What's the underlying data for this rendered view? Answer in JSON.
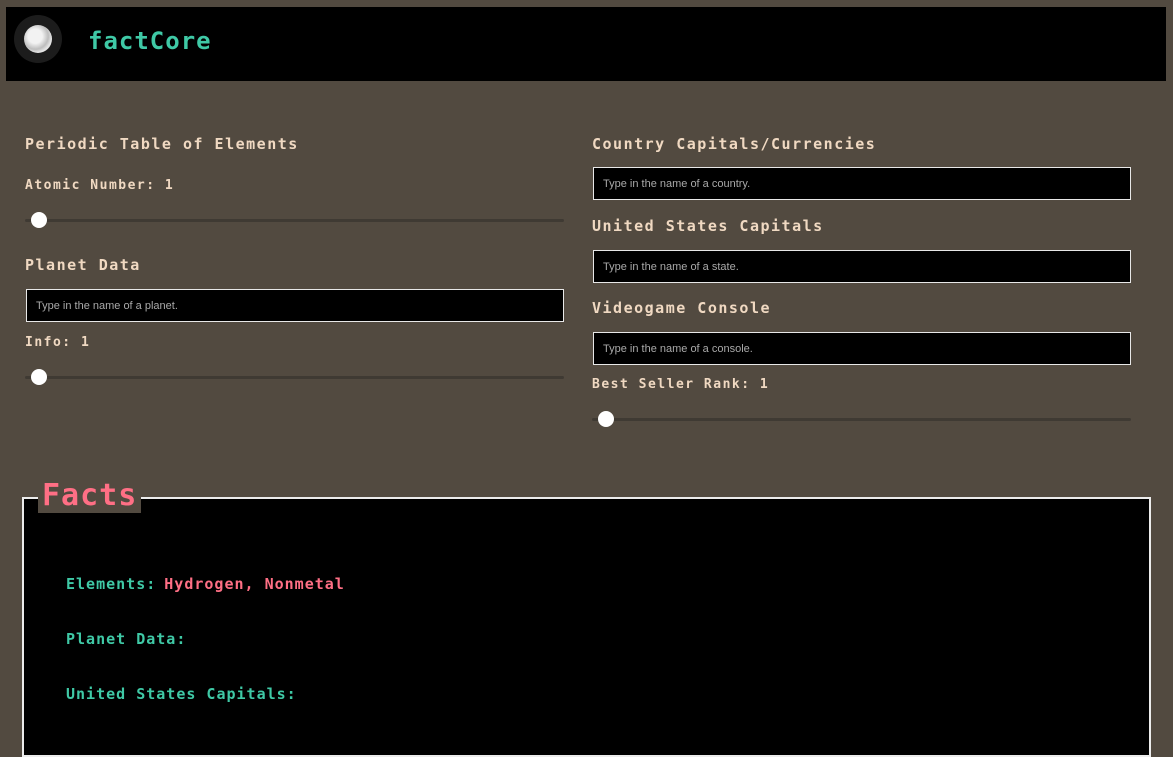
{
  "app": {
    "title": "factCore"
  },
  "left": {
    "periodic": {
      "heading": "Periodic Table of Elements",
      "atomic_label": "Atomic Number:",
      "atomic_value": "1",
      "atomic_level": 0
    },
    "planet": {
      "heading": "Planet Data",
      "placeholder": "Type in the name of a planet.",
      "info_label": "Info:",
      "info_value": "1",
      "info_level": 0
    }
  },
  "right": {
    "country": {
      "heading": "Country Capitals/Currencies",
      "placeholder": "Type in the name of a country."
    },
    "states": {
      "heading": "United States Capitals",
      "placeholder": "Type in the name of a state."
    },
    "console": {
      "heading": "Videogame Console",
      "placeholder": "Type in the name of a console.",
      "rank_label": "Best Seller Rank:",
      "rank_value": "1",
      "rank_level": 0
    }
  },
  "facts": {
    "title": "Facts",
    "rows": [
      {
        "key": "Elements:",
        "value": "Hydrogen, Nonmetal"
      },
      {
        "key": "Planet Data:",
        "value": ""
      },
      {
        "key": "United States Capitals:",
        "value": ""
      }
    ]
  },
  "colors": {
    "accent_green": "#3fc9a6",
    "accent_pink": "#ff6f85",
    "background": "#524a40",
    "label": "#f0d9c2"
  }
}
